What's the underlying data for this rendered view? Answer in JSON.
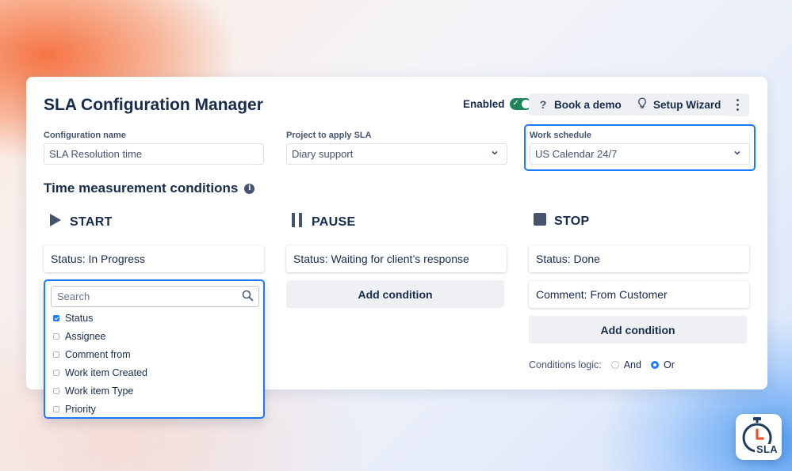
{
  "app": {
    "title": "SLA Configuration Manager"
  },
  "header": {
    "enabled_label": "Enabled",
    "enabled": true,
    "book_demo_label": "Book a demo",
    "setup_wizard_label": "Setup Wizard"
  },
  "form": {
    "config_name": {
      "label": "Configuration name",
      "value": "SLA Resolution time"
    },
    "project": {
      "label": "Project to apply SLA",
      "value": "Diary support"
    },
    "schedule": {
      "label": "Work schedule",
      "value": "US Calendar 24/7"
    }
  },
  "conditions": {
    "title": "Time measurement conditions",
    "start": {
      "label": "START",
      "items": [
        "Status: In Progress"
      ]
    },
    "pause": {
      "label": "PAUSE",
      "items": [
        "Status: Waiting for client’s response"
      ],
      "add_label": "Add condition"
    },
    "stop": {
      "label": "STOP",
      "items": [
        "Status: Done",
        "Comment: From Customer"
      ],
      "add_label": "Add condition"
    },
    "logic": {
      "label": "Conditions logic:",
      "options": [
        "And",
        "Or"
      ],
      "selected": "Or"
    }
  },
  "dropdown": {
    "search_placeholder": "Search",
    "options": [
      {
        "label": "Status",
        "checked": true
      },
      {
        "label": "Assignee",
        "checked": false
      },
      {
        "label": "Comment from",
        "checked": false
      },
      {
        "label": "Work item Created",
        "checked": false
      },
      {
        "label": "Work item Type",
        "checked": false
      },
      {
        "label": "Priority",
        "checked": false
      }
    ]
  },
  "badge": {
    "text": "SLA"
  },
  "colors": {
    "accent": "#1d7afc",
    "toggle_on": "#1f845a",
    "text": "#172b4d",
    "badge_orange": "#e8552e"
  }
}
